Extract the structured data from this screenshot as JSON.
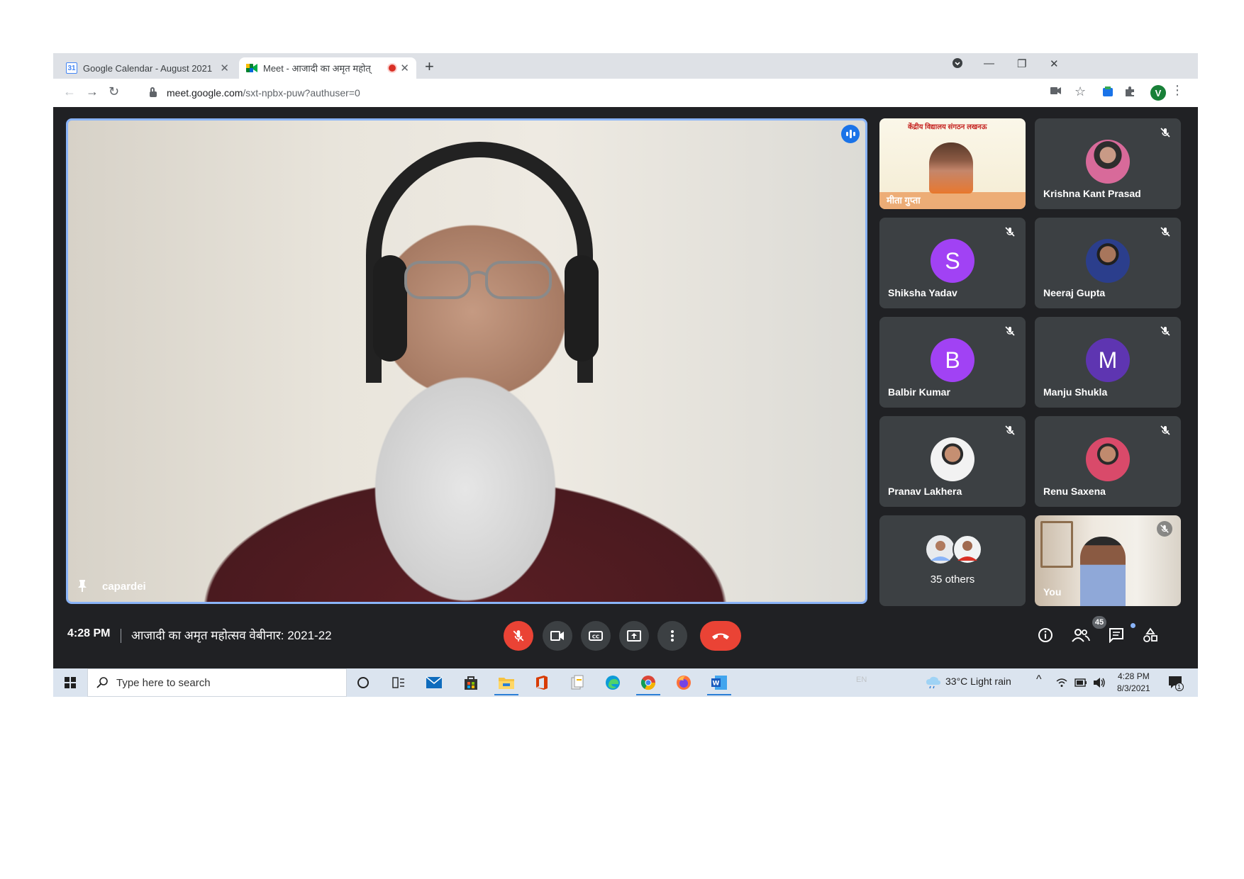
{
  "browser": {
    "tabs": [
      {
        "title": "Google Calendar - August 2021",
        "favicon": "calendar-favicon",
        "favicon_text": "31",
        "active": false
      },
      {
        "title": "Meet - आजादी का अमृत महोत्",
        "favicon": "meet-favicon",
        "active": true,
        "recording": true
      }
    ],
    "url_host": "meet.google.com",
    "url_path": "/sxt-npbx-puw?authuser=0",
    "profile_initial": "V"
  },
  "meet": {
    "main_speaker": {
      "name": "capardei",
      "pinned": true,
      "speaking": true
    },
    "tiles": [
      {
        "name": "",
        "kind": "banner",
        "banner_text": "केंद्रीय विद्यालय संगठन लखनऊ",
        "banner_caption": "मीता गुप्ता"
      },
      {
        "name": "Krishna Kant Prasad",
        "kind": "photo",
        "muted": true
      },
      {
        "name": "Shiksha Yadav",
        "kind": "letter",
        "letter": "S",
        "color": "#a142f4",
        "muted": true
      },
      {
        "name": "Neeraj Gupta",
        "kind": "photo",
        "muted": true
      },
      {
        "name": "Balbir Kumar",
        "kind": "letter",
        "letter": "B",
        "color": "#a142f4",
        "muted": true
      },
      {
        "name": "Manju Shukla",
        "kind": "letter",
        "letter": "M",
        "color": "#5e35b1",
        "muted": true
      },
      {
        "name": "Pranav Lakhera",
        "kind": "photo",
        "muted": true
      },
      {
        "name": "Renu Saxena",
        "kind": "photo",
        "muted": true
      },
      {
        "name": "35 others",
        "kind": "others"
      },
      {
        "name": "You",
        "kind": "self",
        "muted": true
      }
    ],
    "time": "4:28 PM",
    "meeting_title": "आजादी का अमृत महोत्सव वेबीनार: 2021-22",
    "participant_count": "45",
    "accent_color": "#8ab4f8",
    "danger_color": "#ea4335"
  },
  "taskbar": {
    "search_placeholder": "Type here to search",
    "lang": "EN",
    "weather": "33°C  Light rain",
    "clock_time": "4:28 PM",
    "clock_date": "8/3/2021",
    "notification_count": "1"
  }
}
